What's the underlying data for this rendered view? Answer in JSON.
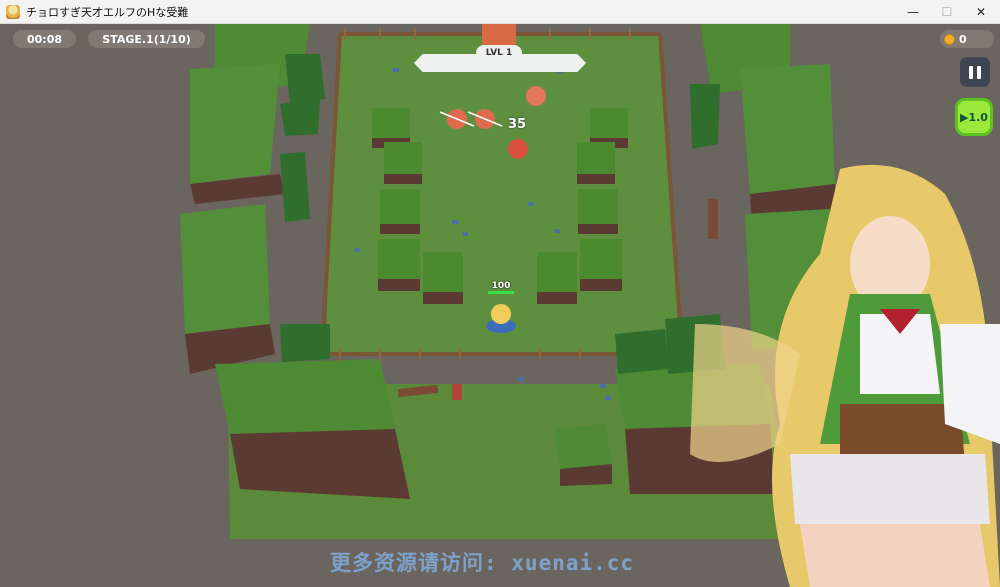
{
  "window": {
    "title": "チョロすぎ天才エルフのHな受難",
    "controls": {
      "minimize": "—",
      "maximize": "☐",
      "close": "✕"
    }
  },
  "hud": {
    "timer": "00:08",
    "stage": "STAGE.1(1/10)",
    "coins": "0",
    "level": "LVL 1",
    "speed": "▶1.0"
  },
  "player": {
    "hp_text": "100",
    "hp_fraction": 1.0
  },
  "combat": {
    "damage_popup": "35"
  },
  "watermark": "更多资源请访问: xuenai.cc",
  "colors": {
    "grass": "#5d8a3c",
    "cliff_top": "#4e8a36",
    "cliff_side": "#5a3a33",
    "fence": "#7a5636",
    "speed_button": "#9be83d"
  }
}
